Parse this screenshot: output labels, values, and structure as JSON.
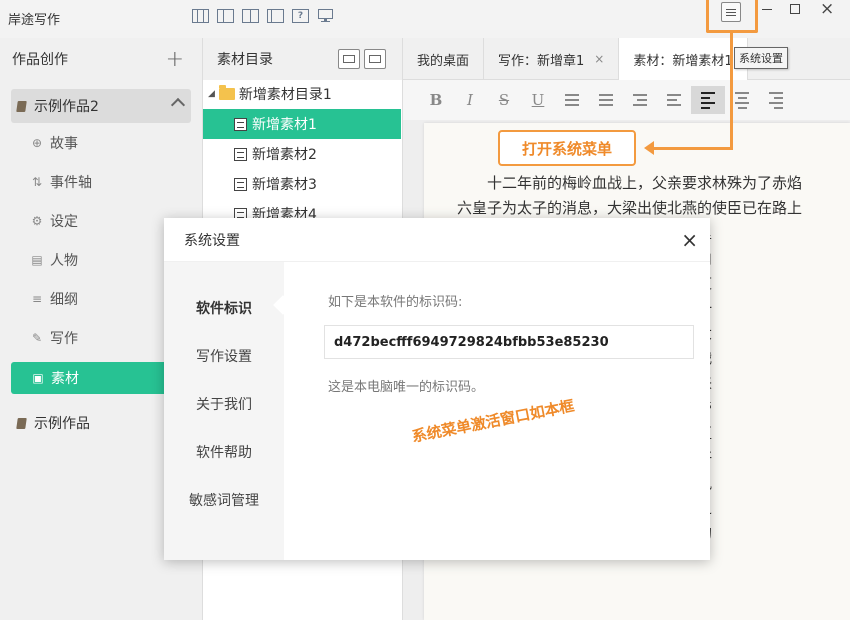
{
  "app": {
    "title": "岸途写作",
    "tooltip": "系统设置"
  },
  "sidebar": {
    "header": "作品创作",
    "add": "+",
    "works": [
      {
        "label": "示例作品2"
      },
      {
        "label": "示例作品"
      }
    ],
    "nav": [
      {
        "label": "故事",
        "icon": "globe-icon"
      },
      {
        "label": "事件轴",
        "icon": "timeline-icon"
      },
      {
        "label": "设定",
        "icon": "gears-icon"
      },
      {
        "label": "人物",
        "icon": "id-card-icon"
      },
      {
        "label": "细纲",
        "icon": "list-icon"
      },
      {
        "label": "写作",
        "icon": "pencil-icon"
      },
      {
        "label": "素材",
        "icon": "image-icon"
      }
    ]
  },
  "materials": {
    "header": "素材目录",
    "folder": "新增素材目录1",
    "items": [
      "新增素材1",
      "新增素材2",
      "新增素材3",
      "新增素材4"
    ]
  },
  "tabs": [
    {
      "label": "我的桌面"
    },
    {
      "label": "写作：新增章1",
      "close": "×"
    },
    {
      "label": "素材：新增素材1"
    }
  ],
  "toolbar": [
    "B",
    "I",
    "S",
    "U"
  ],
  "editor": {
    "lines": [
      "　　十二年前的梅岭血战上，父亲要求林殊为了赤焰",
      "六皇子为太子的消息，大梁出使北燕的使臣已在路上",
      "　　　　　　　　了一个锦囊，锦囊里",
      "　　　　　　　　争夺皇位，派天泉山",
      "　　　　　　　　方可打开，蔺晨知道",
      "　　　　　　　　苏，都欲抢先对方一",
      "　　　　　　　　压之子景睿和豫津大",
      "　　　　　　　　在梅岭打了那场血战",
      "　　　　　　　　乃旧是体弱多病，来",
      "　　　　　　　　一起去金陵。大梁帝",
      "　　　　　　　　只是梅长苏并没有直",
      "　　　　　　　　友，平日里身体不好",
      "　　　　　　　　苏哲。梁帝要在迎凤",
      "　　　　　　　　其真遇到命中注定之",
      "　　　　　　　　京状告庆国工亲族的",
      "　　　　　　　　　　　　　　　　　　"
    ]
  },
  "annotation": {
    "menu_callout": "打开系统菜单",
    "window_callout": "系统菜单激活窗口如本框"
  },
  "modal": {
    "title": "系统设置",
    "close": "×",
    "nav": [
      "软件标识",
      "写作设置",
      "关于我们",
      "软件帮助",
      "敏感词管理"
    ],
    "label": "如下是本软件的标识码:",
    "code": "d472becfff6949729824bfbb53e85230",
    "note": "这是本电脑唯一的标识码。"
  },
  "colors": {
    "accent": "#27c293",
    "annotation": "#f39a3f"
  }
}
